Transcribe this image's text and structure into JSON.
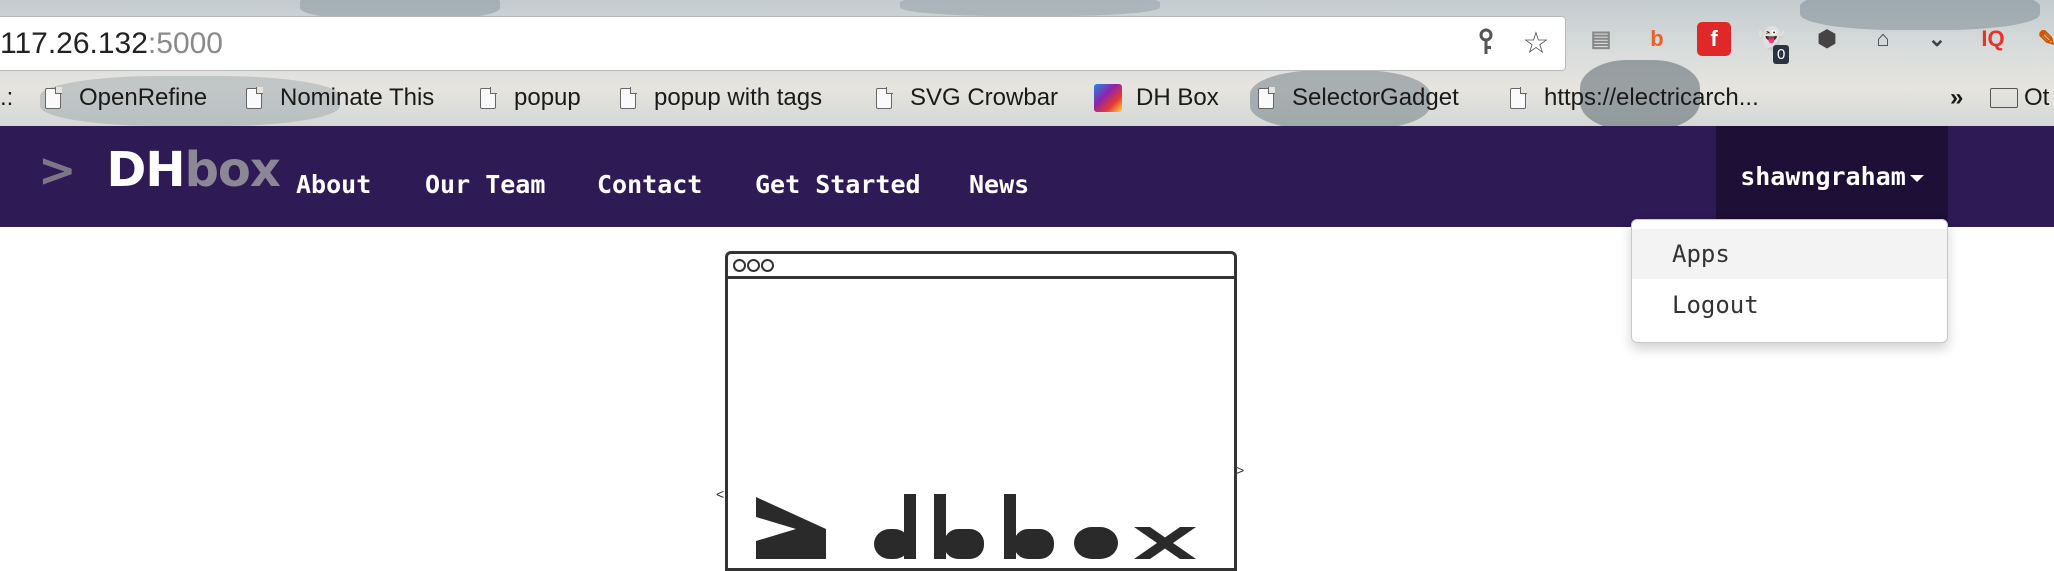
{
  "browser": {
    "url_host": "117.26.132",
    "url_port": ":5000",
    "omnibox_icons": [
      "key-icon",
      "star-icon"
    ],
    "extensions": [
      {
        "name": "document-icon",
        "glyph": "▤",
        "color": "#888888"
      },
      {
        "name": "bitly-icon",
        "glyph": "b",
        "color": "#ee6123"
      },
      {
        "name": "flipboard-icon",
        "glyph": "f",
        "color": "#e12828"
      },
      {
        "name": "ghostery-icon",
        "glyph": "👻",
        "color": "#36a9e1",
        "badge": "0"
      },
      {
        "name": "shield-icon",
        "glyph": "⬢",
        "color": "#444444"
      },
      {
        "name": "plug-icon",
        "glyph": "⌂",
        "color": "#444444"
      },
      {
        "name": "pocket-icon",
        "glyph": "⌄",
        "color": "#444444"
      },
      {
        "name": "iq-icon",
        "glyph": "IQ",
        "color": "#e8322a"
      },
      {
        "name": "feather-icon",
        "glyph": "✎",
        "color": "#cc5500"
      }
    ],
    "bookmarks": [
      {
        "label": "OpenRefine",
        "icon": "page-icon"
      },
      {
        "label": "Nominate This",
        "icon": "page-icon"
      },
      {
        "label": "popup",
        "icon": "page-icon"
      },
      {
        "label": "popup with tags",
        "icon": "page-icon"
      },
      {
        "label": "SVG Crowbar",
        "icon": "page-icon"
      },
      {
        "label": "DH Box",
        "icon": "wand-icon"
      },
      {
        "label": "SelectorGadget",
        "icon": "page-icon"
      },
      {
        "label": "https://electricarch...",
        "icon": "page-icon"
      }
    ],
    "bookmarks_overflow": "»",
    "bookmarks_folder_partial": "Ot"
  },
  "site": {
    "brand": {
      "prompt": ">",
      "dh": "DH",
      "box": "box"
    },
    "nav": [
      "About",
      "Our Team",
      "Contact",
      "Get Started",
      "News"
    ],
    "user": "shawngraham",
    "dropdown": [
      {
        "label": "Apps",
        "active": true
      },
      {
        "label": "Logout",
        "active": false
      }
    ],
    "colors": {
      "navbar": "#2e1a54",
      "user_toggle": "#1d0f35"
    }
  }
}
